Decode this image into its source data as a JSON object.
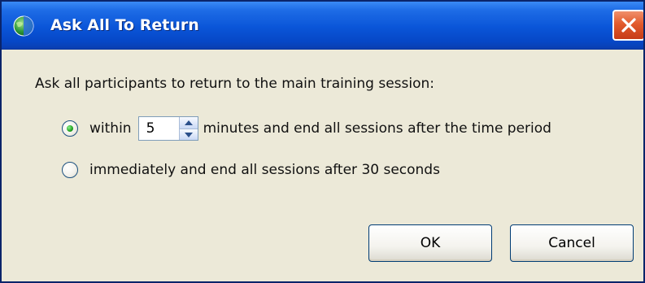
{
  "window": {
    "title": "Ask All To Return",
    "app_icon": "globe-icon",
    "close_icon": "close-icon"
  },
  "prompt": "Ask all participants to return to the main training session:",
  "options": [
    {
      "selected": true,
      "prefix": "within",
      "minutes_value": "5",
      "suffix": "minutes and end all sessions after the time period"
    },
    {
      "selected": false,
      "label": "immediately and end all sessions after 30 seconds"
    }
  ],
  "buttons": {
    "ok": "OK",
    "cancel": "Cancel"
  },
  "colors": {
    "titlebar": "#0a55d8",
    "close_button": "#e25a2c",
    "dialog_background": "#ece9d8",
    "selected_radio": "#21a121"
  }
}
